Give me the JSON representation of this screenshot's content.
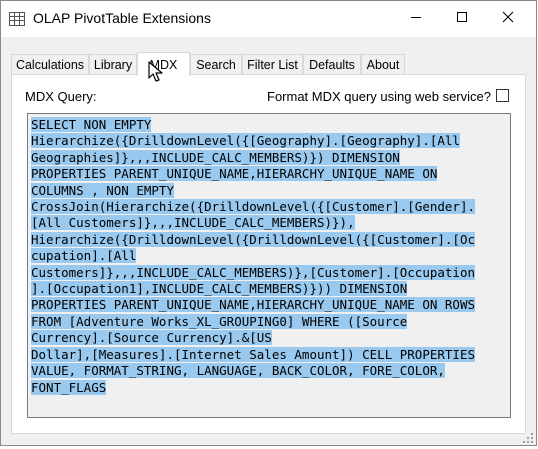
{
  "window": {
    "title": "OLAP PivotTable Extensions"
  },
  "tabs": [
    {
      "label": "Calculations",
      "active": false
    },
    {
      "label": "Library",
      "active": false
    },
    {
      "label": "MDX",
      "active": true
    },
    {
      "label": "Search",
      "active": false
    },
    {
      "label": "Filter List",
      "active": false
    },
    {
      "label": "Defaults",
      "active": false
    },
    {
      "label": "About",
      "active": false
    }
  ],
  "mdx_panel": {
    "query_label": "MDX Query:",
    "format_option_label": "Format MDX query using web service?",
    "format_option_checked": false,
    "query_lines": [
      "SELECT NON EMPTY",
      "Hierarchize({DrilldownLevel({[Geography].[Geography].[All",
      "Geographies]},,,INCLUDE_CALC_MEMBERS)}) DIMENSION",
      "PROPERTIES PARENT_UNIQUE_NAME,HIERARCHY_UNIQUE_NAME ON",
      "COLUMNS , NON EMPTY",
      "CrossJoin(Hierarchize({DrilldownLevel({[Customer].[Gender].",
      "[All Customers]},,,INCLUDE_CALC_MEMBERS)}),",
      "Hierarchize({DrilldownLevel({DrilldownLevel({[Customer].[Oc",
      "cupation].[All",
      "Customers]},,,INCLUDE_CALC_MEMBERS)},[Customer].[Occupation",
      "].[Occupation1],INCLUDE_CALC_MEMBERS)})) DIMENSION",
      "PROPERTIES PARENT_UNIQUE_NAME,HIERARCHY_UNIQUE_NAME ON ROWS",
      "FROM [Adventure Works_XL_GROUPING0] WHERE ([Source",
      "Currency].[Source Currency].&[US",
      "Dollar],[Measures].[Internet Sales Amount]) CELL PROPERTIES",
      "VALUE, FORMAT_STRING, LANGUAGE, BACK_COLOR, FORE_COLOR,",
      "FONT_FLAGS"
    ]
  },
  "icons": {
    "app": "app-table-icon",
    "minimize": "minimize-icon",
    "maximize": "maximize-icon",
    "close": "close-icon",
    "cursor": "mouse-pointer-icon"
  },
  "colors": {
    "selection_highlight": "#99c9ef",
    "panel_bg": "#ffffff",
    "window_bg": "#f0f0f0"
  }
}
